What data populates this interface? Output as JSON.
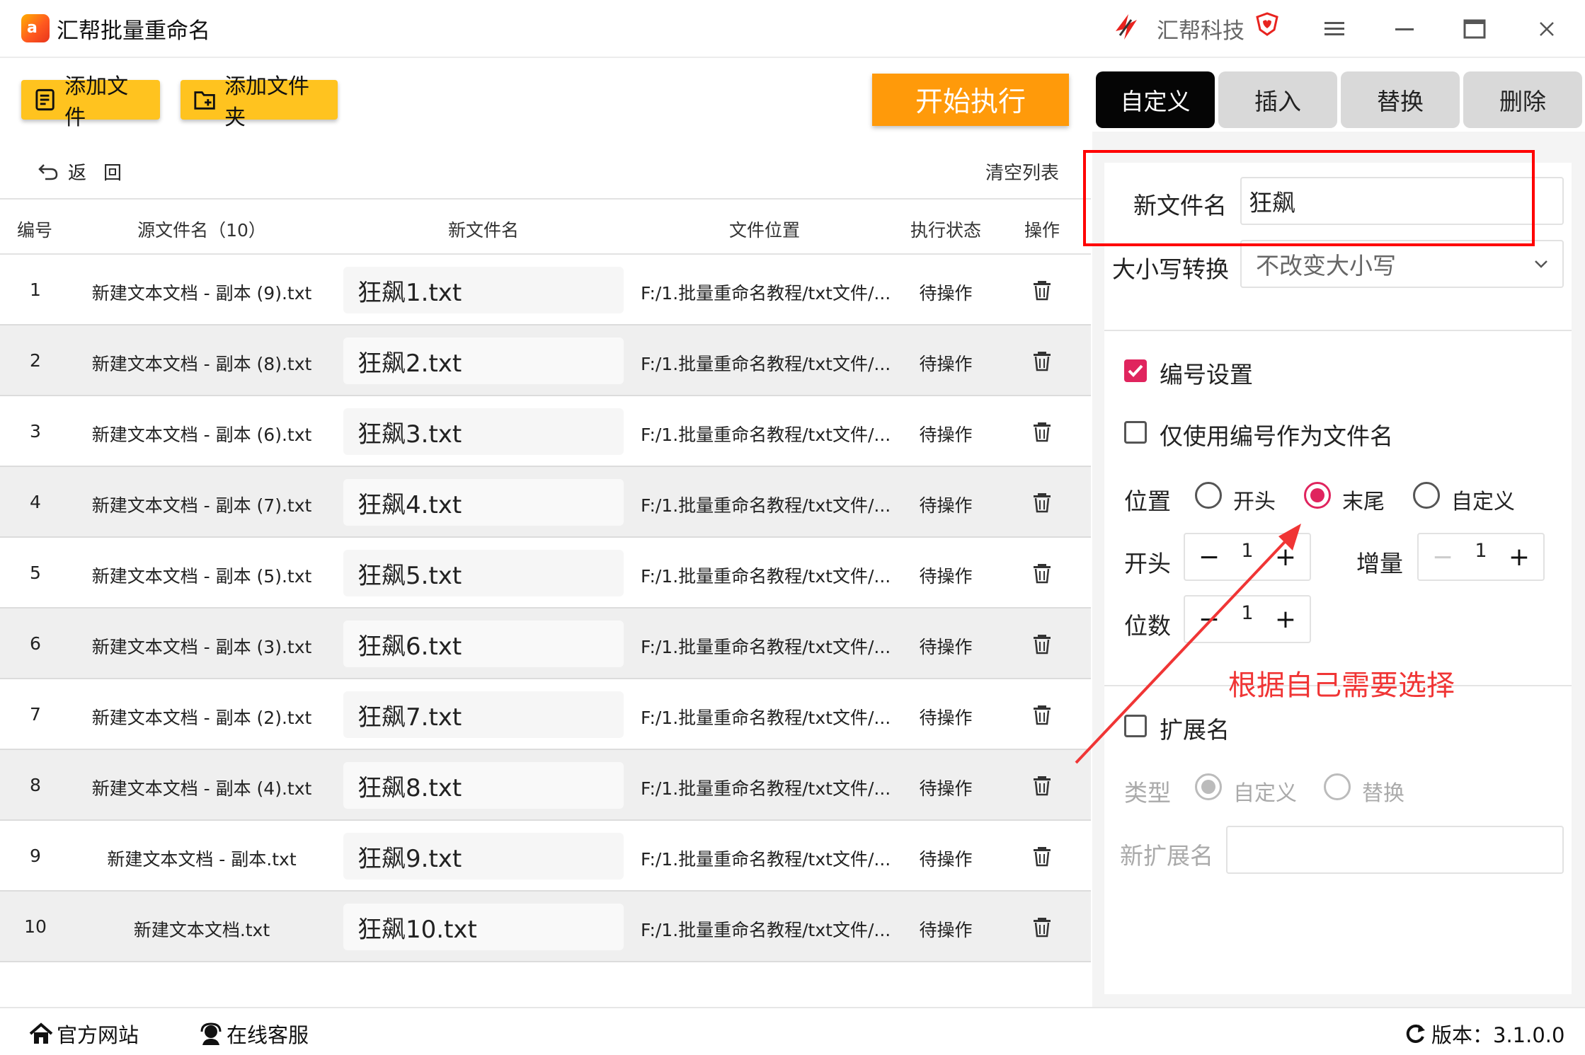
{
  "titlebar": {
    "title": "汇帮批量重命名",
    "logo_text": "a",
    "brand": "汇帮科技"
  },
  "toolbar": {
    "add_file": "添加文件",
    "add_folder": "添加文件夹",
    "start": "开始执行"
  },
  "tabs": [
    {
      "label": "自定义",
      "active": true
    },
    {
      "label": "插入",
      "active": false
    },
    {
      "label": "替换",
      "active": false
    },
    {
      "label": "删除",
      "active": false
    }
  ],
  "list": {
    "back_label": "返回",
    "clear_label": "清空列表",
    "headers": {
      "num": "编号",
      "source": "源文件名（10）",
      "newname": "新文件名",
      "location": "文件位置",
      "status": "执行状态",
      "action": "操作"
    },
    "rows": [
      {
        "num": "1",
        "source": "新建文本文档 - 副本 (9).txt",
        "newname": "狂飙1.txt",
        "location": "F:/1.批量重命名教程/txt文件/...",
        "status": "待操作"
      },
      {
        "num": "2",
        "source": "新建文本文档 - 副本 (8).txt",
        "newname": "狂飙2.txt",
        "location": "F:/1.批量重命名教程/txt文件/...",
        "status": "待操作"
      },
      {
        "num": "3",
        "source": "新建文本文档 - 副本 (6).txt",
        "newname": "狂飙3.txt",
        "location": "F:/1.批量重命名教程/txt文件/...",
        "status": "待操作"
      },
      {
        "num": "4",
        "source": "新建文本文档 - 副本 (7).txt",
        "newname": "狂飙4.txt",
        "location": "F:/1.批量重命名教程/txt文件/...",
        "status": "待操作"
      },
      {
        "num": "5",
        "source": "新建文本文档 - 副本 (5).txt",
        "newname": "狂飙5.txt",
        "location": "F:/1.批量重命名教程/txt文件/...",
        "status": "待操作"
      },
      {
        "num": "6",
        "source": "新建文本文档 - 副本 (3).txt",
        "newname": "狂飙6.txt",
        "location": "F:/1.批量重命名教程/txt文件/...",
        "status": "待操作"
      },
      {
        "num": "7",
        "source": "新建文本文档 - 副本 (2).txt",
        "newname": "狂飙7.txt",
        "location": "F:/1.批量重命名教程/txt文件/...",
        "status": "待操作"
      },
      {
        "num": "8",
        "source": "新建文本文档 - 副本 (4).txt",
        "newname": "狂飙8.txt",
        "location": "F:/1.批量重命名教程/txt文件/...",
        "status": "待操作"
      },
      {
        "num": "9",
        "source": "新建文本文档 - 副本.txt",
        "newname": "狂飙9.txt",
        "location": "F:/1.批量重命名教程/txt文件/...",
        "status": "待操作"
      },
      {
        "num": "10",
        "source": "新建文本文档.txt",
        "newname": "狂飙10.txt",
        "location": "F:/1.批量重命名教程/txt文件/...",
        "status": "待操作"
      }
    ]
  },
  "panel": {
    "newname_label": "新文件名",
    "newname_value": "狂飙",
    "case_label": "大小写转换",
    "case_value": "不改变大小写",
    "numbering_label": "编号设置",
    "numbering_checked": true,
    "only_number_label": "仅使用编号作为文件名",
    "only_number_checked": false,
    "position_label": "位置",
    "position_options": [
      "开头",
      "末尾",
      "自定义"
    ],
    "position_selected": "末尾",
    "start_label": "开头",
    "start_value": "1",
    "increment_label": "增量",
    "increment_value": "1",
    "digits_label": "位数",
    "digits_value": "1",
    "ext_label": "扩展名",
    "ext_checked": false,
    "type_label": "类型",
    "type_options": [
      "自定义",
      "替换"
    ],
    "type_selected": "自定义",
    "new_ext_label": "新扩展名",
    "new_ext_value": ""
  },
  "annotation": {
    "text": "根据自己需要选择",
    "color": "#f03535"
  },
  "footer": {
    "website": "官方网站",
    "support": "在线客服",
    "version": "版本：3.1.0.0"
  },
  "colors": {
    "accent_pink": "#e0245e",
    "yellow": "#ffc31f",
    "orange": "#ff9a0a"
  }
}
